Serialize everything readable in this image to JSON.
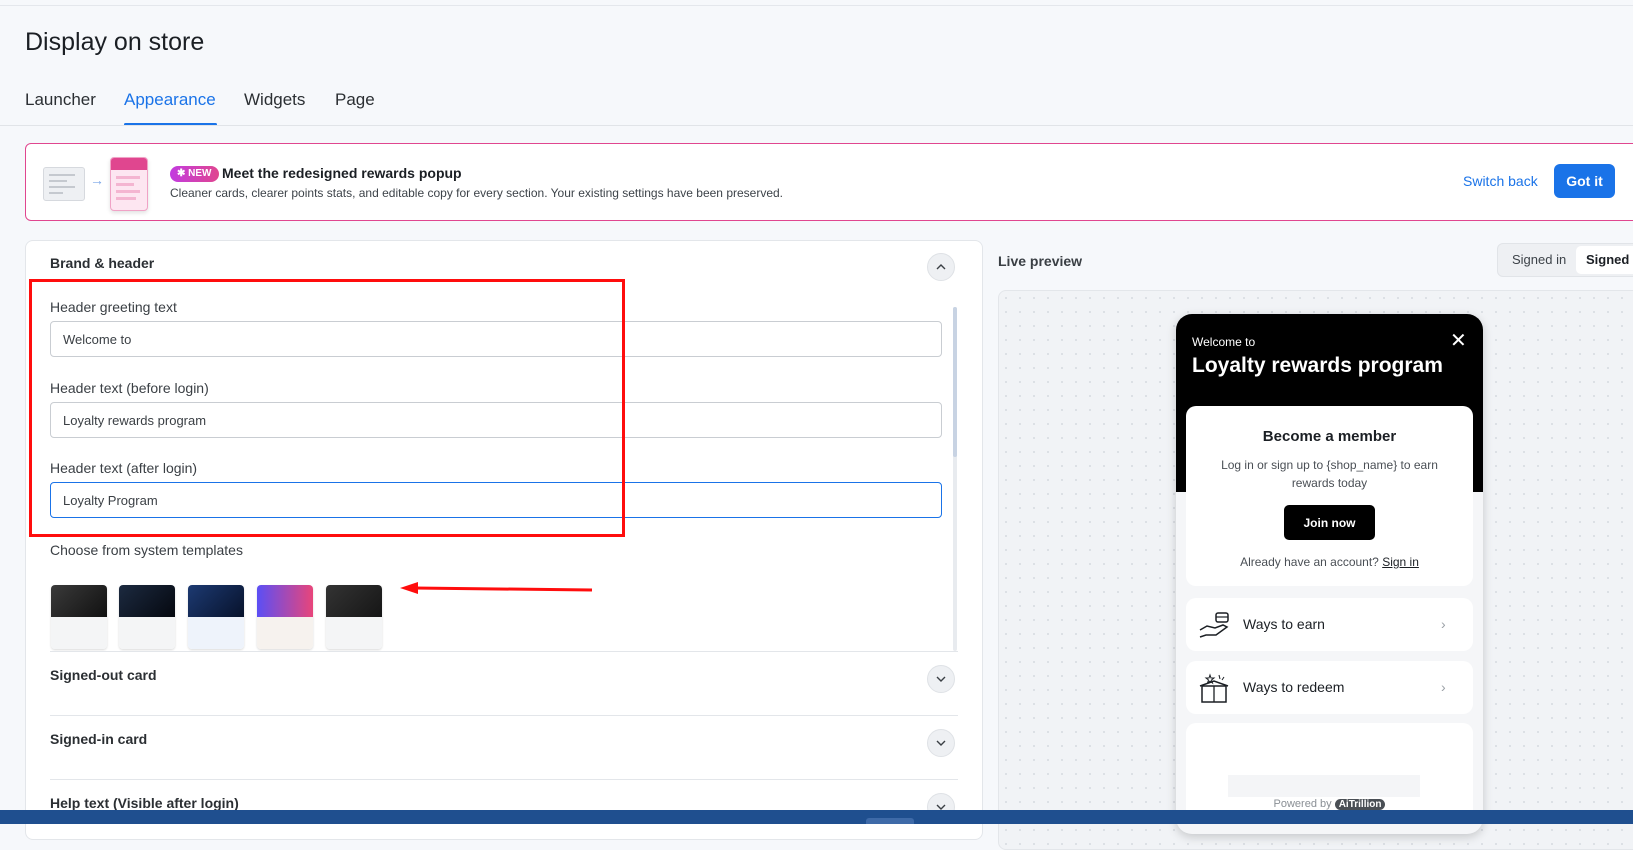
{
  "page": {
    "title": "Display on store"
  },
  "tabs": [
    {
      "label": "Launcher"
    },
    {
      "label": "Appearance"
    },
    {
      "label": "Widgets"
    },
    {
      "label": "Page"
    }
  ],
  "tabs_active": "Appearance",
  "banner": {
    "badge": "✱ NEW",
    "title": "Meet the redesigned rewards popup",
    "description": "Cleaner cards, clearer points stats, and editable copy for every section. Your existing settings have been preserved.",
    "switch_back": "Switch back",
    "got_it": "Got it"
  },
  "brand_header": {
    "title": "Brand & header",
    "fields": [
      {
        "label": "Header greeting text",
        "value": "Welcome to"
      },
      {
        "label": "Header text (before login)",
        "value": "Loyalty rewards program"
      },
      {
        "label": "Header text (after login)",
        "value": "Loyalty Program"
      }
    ],
    "templates_label": "Choose from system templates",
    "templates": [
      {
        "name": "template-1",
        "color": "#1f1f1f"
      },
      {
        "name": "template-2",
        "color": "#0b1424"
      },
      {
        "name": "template-3",
        "color": "#0f2247"
      },
      {
        "name": "template-4",
        "color": "#6a4cf2"
      },
      {
        "name": "template-5",
        "color": "#262626"
      }
    ]
  },
  "sections": [
    {
      "title": "Signed-out card"
    },
    {
      "title": "Signed-in card"
    },
    {
      "title": "Help text (Visible after login)"
    }
  ],
  "preview": {
    "label": "Live preview",
    "toggle": [
      "Signed in",
      "Signed"
    ],
    "toggle_active": "Signed"
  },
  "popup": {
    "welcome": "Welcome to",
    "title": "Loyalty rewards program",
    "close_icon": "✕",
    "member_title": "Become a member",
    "member_sub": "Log in or sign up to {shop_name} to earn rewards today",
    "join": "Join now",
    "already": "Already have an account?",
    "sign_in": "Sign in",
    "ways": [
      {
        "label": "Ways to earn",
        "icon": "hand-coins-icon"
      },
      {
        "label": "Ways to redeem",
        "icon": "gift-box-icon"
      }
    ],
    "chevron": "›",
    "powered_by": "Powered by",
    "brand": "AiTrillion"
  },
  "colors": {
    "accent": "#1a73e8",
    "banner_border": "#e0468f",
    "annotation": "#ff0d0d",
    "popup_header": "#000000"
  }
}
